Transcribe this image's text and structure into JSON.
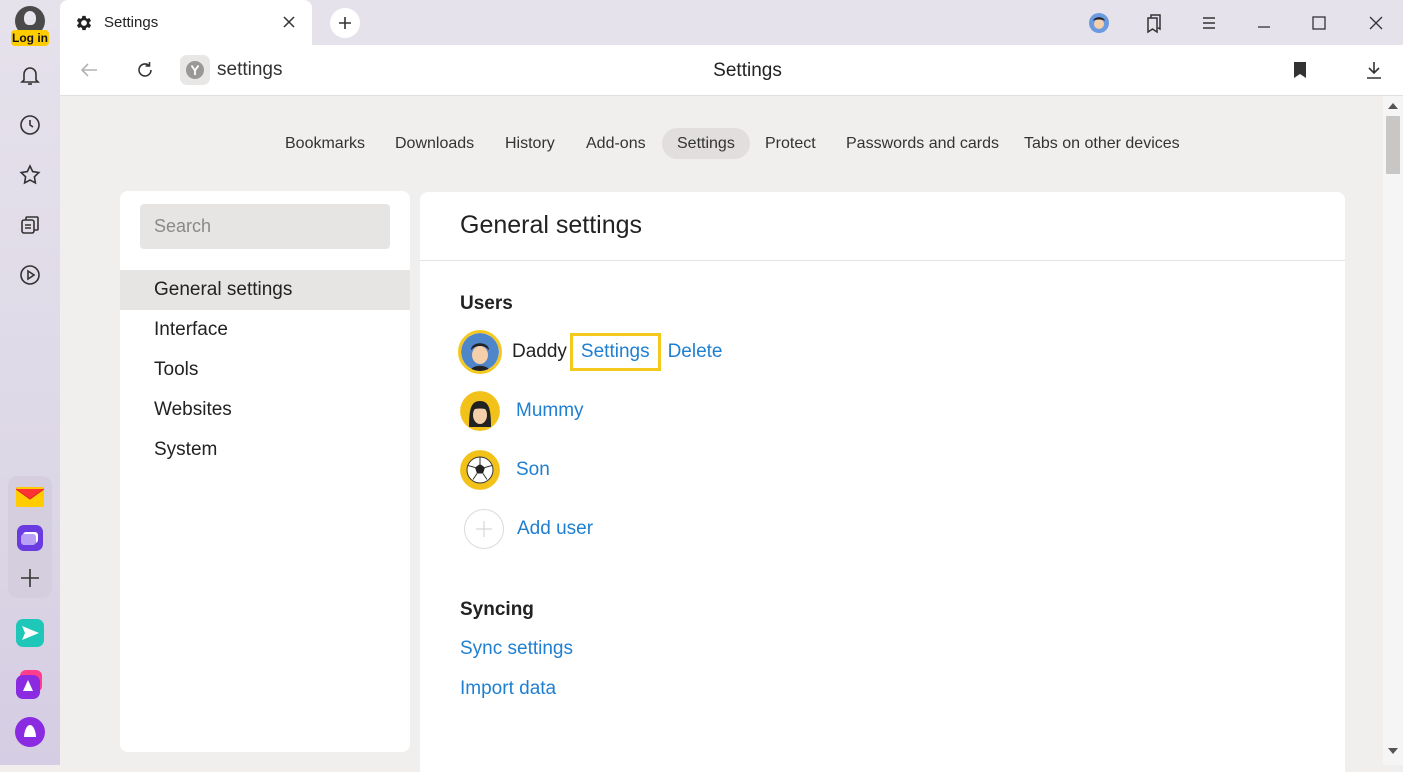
{
  "rail": {
    "login_label": "Log in"
  },
  "tab": {
    "title": "Settings"
  },
  "address": {
    "url": "settings",
    "center_title": "Settings"
  },
  "topnav": {
    "items": [
      {
        "label": "Bookmarks"
      },
      {
        "label": "Downloads"
      },
      {
        "label": "History"
      },
      {
        "label": "Add-ons"
      },
      {
        "label": "Settings"
      },
      {
        "label": "Protect"
      },
      {
        "label": "Passwords and cards"
      },
      {
        "label": "Tabs on other devices"
      }
    ]
  },
  "sidebar": {
    "search_placeholder": "Search",
    "items": [
      {
        "label": "General settings"
      },
      {
        "label": "Interface"
      },
      {
        "label": "Tools"
      },
      {
        "label": "Websites"
      },
      {
        "label": "System"
      }
    ]
  },
  "panel": {
    "title": "General settings",
    "users_heading": "Users",
    "users": [
      {
        "name": "Daddy",
        "settings_label": "Settings",
        "delete_label": "Delete"
      },
      {
        "name": "Mummy"
      },
      {
        "name": "Son"
      }
    ],
    "add_user_label": "Add user",
    "syncing_heading": "Syncing",
    "sync_settings_label": "Sync settings",
    "import_data_label": "Import data"
  },
  "colors": {
    "link": "#1f7fd1",
    "highlight": "#f4c81c",
    "login_badge": "#ffcc00"
  }
}
